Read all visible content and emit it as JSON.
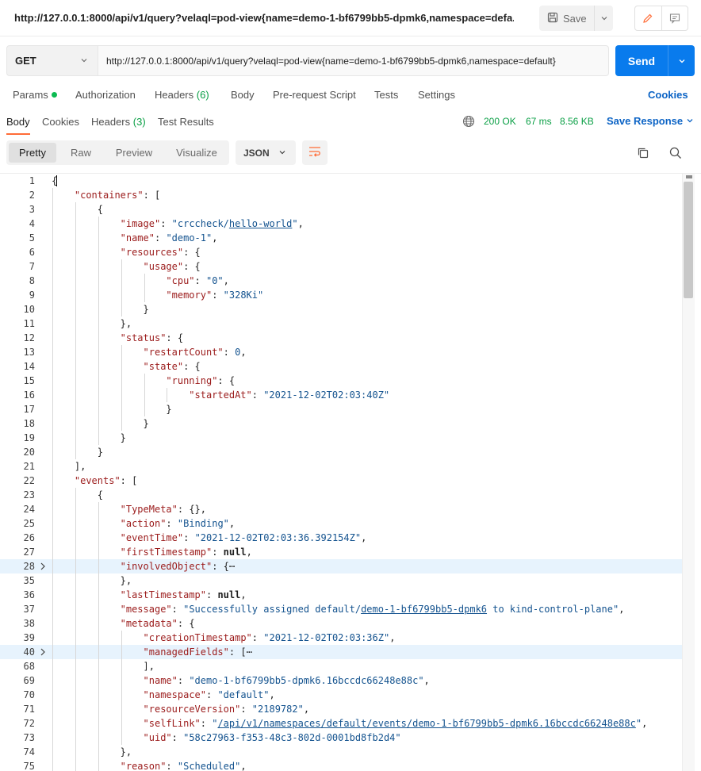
{
  "titlebar": {
    "title": "http://127.0.0.1:8000/api/v1/query?velaql=pod-view{name=demo-1-bf6799bb5-dpmk6,namespace=defa...",
    "save_label": "Save"
  },
  "request": {
    "method": "GET",
    "url": "http://127.0.0.1:8000/api/v1/query?velaql=pod-view{name=demo-1-bf6799bb5-dpmk6,namespace=default}",
    "send_label": "Send"
  },
  "request_tabs": {
    "params": "Params",
    "authorization": "Authorization",
    "headers": "Headers",
    "headers_count": "(6)",
    "body": "Body",
    "pre_request": "Pre-request Script",
    "tests": "Tests",
    "settings": "Settings",
    "cookies": "Cookies"
  },
  "response_tabs": {
    "body": "Body",
    "cookies": "Cookies",
    "headers": "Headers",
    "headers_count": "(3)",
    "test_results": "Test Results",
    "status": "200 OK",
    "time": "67 ms",
    "size": "8.56 KB",
    "save_response": "Save Response"
  },
  "format": {
    "options": [
      "Pretty",
      "Raw",
      "Preview",
      "Visualize"
    ],
    "active": "Pretty",
    "language": "JSON"
  },
  "code_lines": [
    {
      "num": "1",
      "fold": false,
      "indent": 0,
      "tokens": [
        {
          "t": "p",
          "v": "{"
        }
      ]
    },
    {
      "num": "2",
      "fold": false,
      "indent": 1,
      "tokens": [
        {
          "t": "k",
          "v": "\"containers\""
        },
        {
          "t": "p",
          "v": ": ["
        }
      ]
    },
    {
      "num": "3",
      "fold": false,
      "indent": 2,
      "tokens": [
        {
          "t": "p",
          "v": "{"
        }
      ]
    },
    {
      "num": "4",
      "fold": false,
      "indent": 3,
      "tokens": [
        {
          "t": "k",
          "v": "\"image\""
        },
        {
          "t": "p",
          "v": ": "
        },
        {
          "t": "s",
          "v": "\"crccheck/"
        },
        {
          "t": "lk",
          "v": "hello-world"
        },
        {
          "t": "s",
          "v": "\""
        },
        {
          "t": "p",
          "v": ","
        }
      ]
    },
    {
      "num": "5",
      "fold": false,
      "indent": 3,
      "tokens": [
        {
          "t": "k",
          "v": "\"name\""
        },
        {
          "t": "p",
          "v": ": "
        },
        {
          "t": "s",
          "v": "\"demo-1\""
        },
        {
          "t": "p",
          "v": ","
        }
      ]
    },
    {
      "num": "6",
      "fold": false,
      "indent": 3,
      "tokens": [
        {
          "t": "k",
          "v": "\"resources\""
        },
        {
          "t": "p",
          "v": ": {"
        }
      ]
    },
    {
      "num": "7",
      "fold": false,
      "indent": 4,
      "tokens": [
        {
          "t": "k",
          "v": "\"usage\""
        },
        {
          "t": "p",
          "v": ": {"
        }
      ]
    },
    {
      "num": "8",
      "fold": false,
      "indent": 5,
      "tokens": [
        {
          "t": "k",
          "v": "\"cpu\""
        },
        {
          "t": "p",
          "v": ": "
        },
        {
          "t": "s",
          "v": "\"0\""
        },
        {
          "t": "p",
          "v": ","
        }
      ]
    },
    {
      "num": "9",
      "fold": false,
      "indent": 5,
      "tokens": [
        {
          "t": "k",
          "v": "\"memory\""
        },
        {
          "t": "p",
          "v": ": "
        },
        {
          "t": "s",
          "v": "\"328Ki\""
        }
      ]
    },
    {
      "num": "10",
      "fold": false,
      "indent": 4,
      "tokens": [
        {
          "t": "p",
          "v": "}"
        }
      ]
    },
    {
      "num": "11",
      "fold": false,
      "indent": 3,
      "tokens": [
        {
          "t": "p",
          "v": "},"
        }
      ]
    },
    {
      "num": "12",
      "fold": false,
      "indent": 3,
      "tokens": [
        {
          "t": "k",
          "v": "\"status\""
        },
        {
          "t": "p",
          "v": ": {"
        }
      ]
    },
    {
      "num": "13",
      "fold": false,
      "indent": 4,
      "tokens": [
        {
          "t": "k",
          "v": "\"restartCount\""
        },
        {
          "t": "p",
          "v": ": "
        },
        {
          "t": "n",
          "v": "0"
        },
        {
          "t": "p",
          "v": ","
        }
      ]
    },
    {
      "num": "14",
      "fold": false,
      "indent": 4,
      "tokens": [
        {
          "t": "k",
          "v": "\"state\""
        },
        {
          "t": "p",
          "v": ": {"
        }
      ]
    },
    {
      "num": "15",
      "fold": false,
      "indent": 5,
      "tokens": [
        {
          "t": "k",
          "v": "\"running\""
        },
        {
          "t": "p",
          "v": ": {"
        }
      ]
    },
    {
      "num": "16",
      "fold": false,
      "indent": 6,
      "tokens": [
        {
          "t": "k",
          "v": "\"startedAt\""
        },
        {
          "t": "p",
          "v": ": "
        },
        {
          "t": "s",
          "v": "\"2021-12-02T02:03:40Z\""
        }
      ]
    },
    {
      "num": "17",
      "fold": false,
      "indent": 5,
      "tokens": [
        {
          "t": "p",
          "v": "}"
        }
      ]
    },
    {
      "num": "18",
      "fold": false,
      "indent": 4,
      "tokens": [
        {
          "t": "p",
          "v": "}"
        }
      ]
    },
    {
      "num": "19",
      "fold": false,
      "indent": 3,
      "tokens": [
        {
          "t": "p",
          "v": "}"
        }
      ]
    },
    {
      "num": "20",
      "fold": false,
      "indent": 2,
      "tokens": [
        {
          "t": "p",
          "v": "}"
        }
      ]
    },
    {
      "num": "21",
      "fold": false,
      "indent": 1,
      "tokens": [
        {
          "t": "p",
          "v": "],"
        }
      ]
    },
    {
      "num": "22",
      "fold": false,
      "indent": 1,
      "tokens": [
        {
          "t": "k",
          "v": "\"events\""
        },
        {
          "t": "p",
          "v": ": ["
        }
      ]
    },
    {
      "num": "23",
      "fold": false,
      "indent": 2,
      "tokens": [
        {
          "t": "p",
          "v": "{"
        }
      ]
    },
    {
      "num": "24",
      "fold": false,
      "indent": 3,
      "tokens": [
        {
          "t": "k",
          "v": "\"TypeMeta\""
        },
        {
          "t": "p",
          "v": ": {},"
        }
      ]
    },
    {
      "num": "25",
      "fold": false,
      "indent": 3,
      "tokens": [
        {
          "t": "k",
          "v": "\"action\""
        },
        {
          "t": "p",
          "v": ": "
        },
        {
          "t": "s",
          "v": "\"Binding\""
        },
        {
          "t": "p",
          "v": ","
        }
      ]
    },
    {
      "num": "26",
      "fold": false,
      "indent": 3,
      "tokens": [
        {
          "t": "k",
          "v": "\"eventTime\""
        },
        {
          "t": "p",
          "v": ": "
        },
        {
          "t": "s",
          "v": "\"2021-12-02T02:03:36.392154Z\""
        },
        {
          "t": "p",
          "v": ","
        }
      ]
    },
    {
      "num": "27",
      "fold": false,
      "indent": 3,
      "tokens": [
        {
          "t": "k",
          "v": "\"firstTimestamp\""
        },
        {
          "t": "p",
          "v": ": "
        },
        {
          "t": "kw",
          "v": "null"
        },
        {
          "t": "p",
          "v": ","
        }
      ]
    },
    {
      "num": "28",
      "fold": true,
      "indent": 3,
      "tokens": [
        {
          "t": "k",
          "v": "\"involvedObject\""
        },
        {
          "t": "p",
          "v": ": {⋯"
        }
      ]
    },
    {
      "num": "35",
      "fold": false,
      "indent": 3,
      "tokens": [
        {
          "t": "p",
          "v": "},"
        }
      ]
    },
    {
      "num": "36",
      "fold": false,
      "indent": 3,
      "tokens": [
        {
          "t": "k",
          "v": "\"lastTimestamp\""
        },
        {
          "t": "p",
          "v": ": "
        },
        {
          "t": "kw",
          "v": "null"
        },
        {
          "t": "p",
          "v": ","
        }
      ]
    },
    {
      "num": "37",
      "fold": false,
      "indent": 3,
      "tokens": [
        {
          "t": "k",
          "v": "\"message\""
        },
        {
          "t": "p",
          "v": ": "
        },
        {
          "t": "s",
          "v": "\"Successfully assigned default/"
        },
        {
          "t": "lk",
          "v": "demo-1-bf6799bb5-dpmk6"
        },
        {
          "t": "s",
          "v": " to kind-control-plane\""
        },
        {
          "t": "p",
          "v": ","
        }
      ]
    },
    {
      "num": "38",
      "fold": false,
      "indent": 3,
      "tokens": [
        {
          "t": "k",
          "v": "\"metadata\""
        },
        {
          "t": "p",
          "v": ": {"
        }
      ]
    },
    {
      "num": "39",
      "fold": false,
      "indent": 4,
      "tokens": [
        {
          "t": "k",
          "v": "\"creationTimestamp\""
        },
        {
          "t": "p",
          "v": ": "
        },
        {
          "t": "s",
          "v": "\"2021-12-02T02:03:36Z\""
        },
        {
          "t": "p",
          "v": ","
        }
      ]
    },
    {
      "num": "40",
      "fold": true,
      "indent": 4,
      "tokens": [
        {
          "t": "k",
          "v": "\"managedFields\""
        },
        {
          "t": "p",
          "v": ": [⋯"
        }
      ]
    },
    {
      "num": "68",
      "fold": false,
      "indent": 4,
      "tokens": [
        {
          "t": "p",
          "v": "],"
        }
      ]
    },
    {
      "num": "69",
      "fold": false,
      "indent": 4,
      "tokens": [
        {
          "t": "k",
          "v": "\"name\""
        },
        {
          "t": "p",
          "v": ": "
        },
        {
          "t": "s",
          "v": "\"demo-1-bf6799bb5-dpmk6.16bccdc66248e88c\""
        },
        {
          "t": "p",
          "v": ","
        }
      ]
    },
    {
      "num": "70",
      "fold": false,
      "indent": 4,
      "tokens": [
        {
          "t": "k",
          "v": "\"namespace\""
        },
        {
          "t": "p",
          "v": ": "
        },
        {
          "t": "s",
          "v": "\"default\""
        },
        {
          "t": "p",
          "v": ","
        }
      ]
    },
    {
      "num": "71",
      "fold": false,
      "indent": 4,
      "tokens": [
        {
          "t": "k",
          "v": "\"resourceVersion\""
        },
        {
          "t": "p",
          "v": ": "
        },
        {
          "t": "s",
          "v": "\"2189782\""
        },
        {
          "t": "p",
          "v": ","
        }
      ]
    },
    {
      "num": "72",
      "fold": false,
      "indent": 4,
      "tokens": [
        {
          "t": "k",
          "v": "\"selfLink\""
        },
        {
          "t": "p",
          "v": ": "
        },
        {
          "t": "s",
          "v": "\""
        },
        {
          "t": "lk",
          "v": "/api/v1/namespaces/default/events/demo-1-bf6799bb5-dpmk6.16bccdc66248e88c"
        },
        {
          "t": "s",
          "v": "\""
        },
        {
          "t": "p",
          "v": ","
        }
      ]
    },
    {
      "num": "73",
      "fold": false,
      "indent": 4,
      "tokens": [
        {
          "t": "k",
          "v": "\"uid\""
        },
        {
          "t": "p",
          "v": ": "
        },
        {
          "t": "s",
          "v": "\"58c27963-f353-48c3-802d-0001bd8fb2d4\""
        }
      ]
    },
    {
      "num": "74",
      "fold": false,
      "indent": 3,
      "tokens": [
        {
          "t": "p",
          "v": "},"
        }
      ]
    },
    {
      "num": "75",
      "fold": false,
      "indent": 3,
      "tokens": [
        {
          "t": "k",
          "v": "\"reason\""
        },
        {
          "t": "p",
          "v": ": "
        },
        {
          "t": "s",
          "v": "\"Scheduled\""
        },
        {
          "t": "p",
          "v": ","
        }
      ]
    }
  ],
  "colors": {
    "accent": "#097bed",
    "tab_underline": "#ff6c37",
    "status_ok": "#0a9f45",
    "link": "#0b63c5"
  }
}
